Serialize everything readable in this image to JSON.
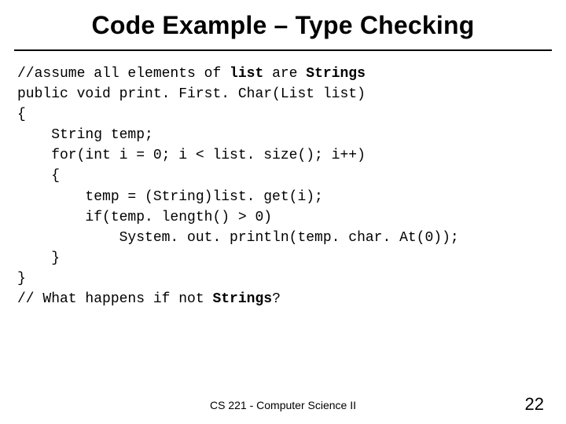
{
  "title": "Code Example – Type Checking",
  "code": {
    "l1a": "//assume all elements of ",
    "l1b": "list",
    "l1c": " are ",
    "l1d": "Strings",
    "l2": "public void print. First. Char(List list)",
    "l3": "{",
    "l4": "    String temp;",
    "l5": "    for(int i = 0; i < list. size(); i++)",
    "l6": "    {",
    "l7": "        temp = (String)list. get(i);",
    "l8": "        if(temp. length() > 0)",
    "l9": "            System. out. println(temp. char. At(0));",
    "l10": "    }",
    "l11": "}",
    "l12a": "// What happens if not ",
    "l12b": "Strings",
    "l12c": "?"
  },
  "footer": {
    "course": "CS 221 - Computer Science II",
    "page": "22"
  }
}
